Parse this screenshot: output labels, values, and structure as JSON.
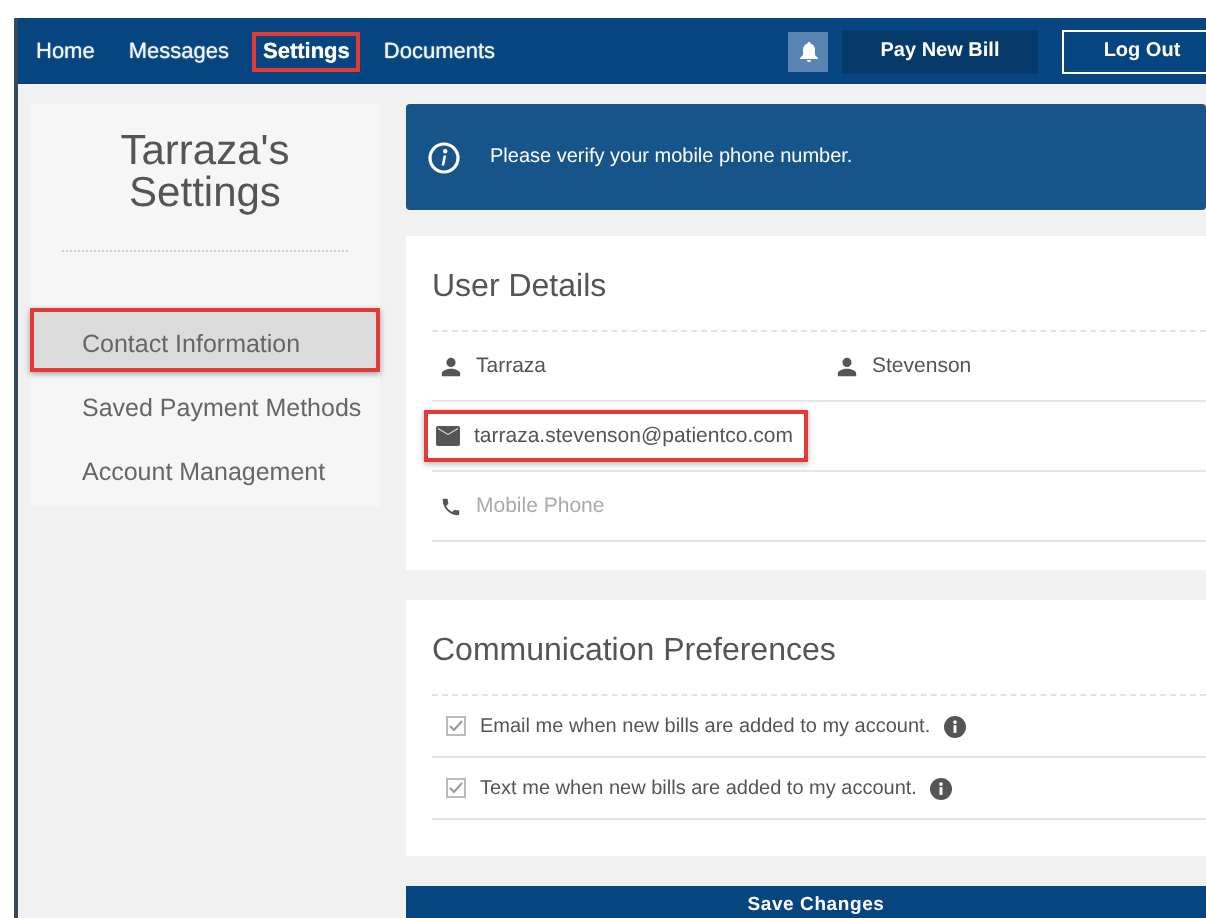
{
  "nav": {
    "links": [
      {
        "label": "Home",
        "selected": false,
        "highlighted": false
      },
      {
        "label": "Messages",
        "selected": false,
        "highlighted": false
      },
      {
        "label": "Settings",
        "selected": true,
        "highlighted": true
      },
      {
        "label": "Documents",
        "selected": false,
        "highlighted": false
      }
    ],
    "pay_button": "Pay New Bill",
    "logout_button": "Log Out"
  },
  "sidebar": {
    "title": "Tarraza's Settings",
    "items": [
      {
        "label": "Contact Information",
        "selected": true,
        "highlighted": true
      },
      {
        "label": "Saved Payment Methods",
        "selected": false,
        "highlighted": false
      },
      {
        "label": "Account Management",
        "selected": false,
        "highlighted": false
      }
    ]
  },
  "banner": {
    "message": "Please verify your mobile phone number."
  },
  "user_details": {
    "heading": "User Details",
    "first_name": "Tarraza",
    "last_name": "Stevenson",
    "email": {
      "value": "tarraza.stevenson@patientco.com",
      "highlighted": true
    },
    "phone": {
      "placeholder": "Mobile Phone"
    }
  },
  "preferences": {
    "heading": "Communication Preferences",
    "options": [
      {
        "label": "Email me when new bills are added to my account.",
        "checked": true
      },
      {
        "label": "Text me when new bills are added to my account.",
        "checked": true
      }
    ]
  },
  "save_button": "Save Changes"
}
